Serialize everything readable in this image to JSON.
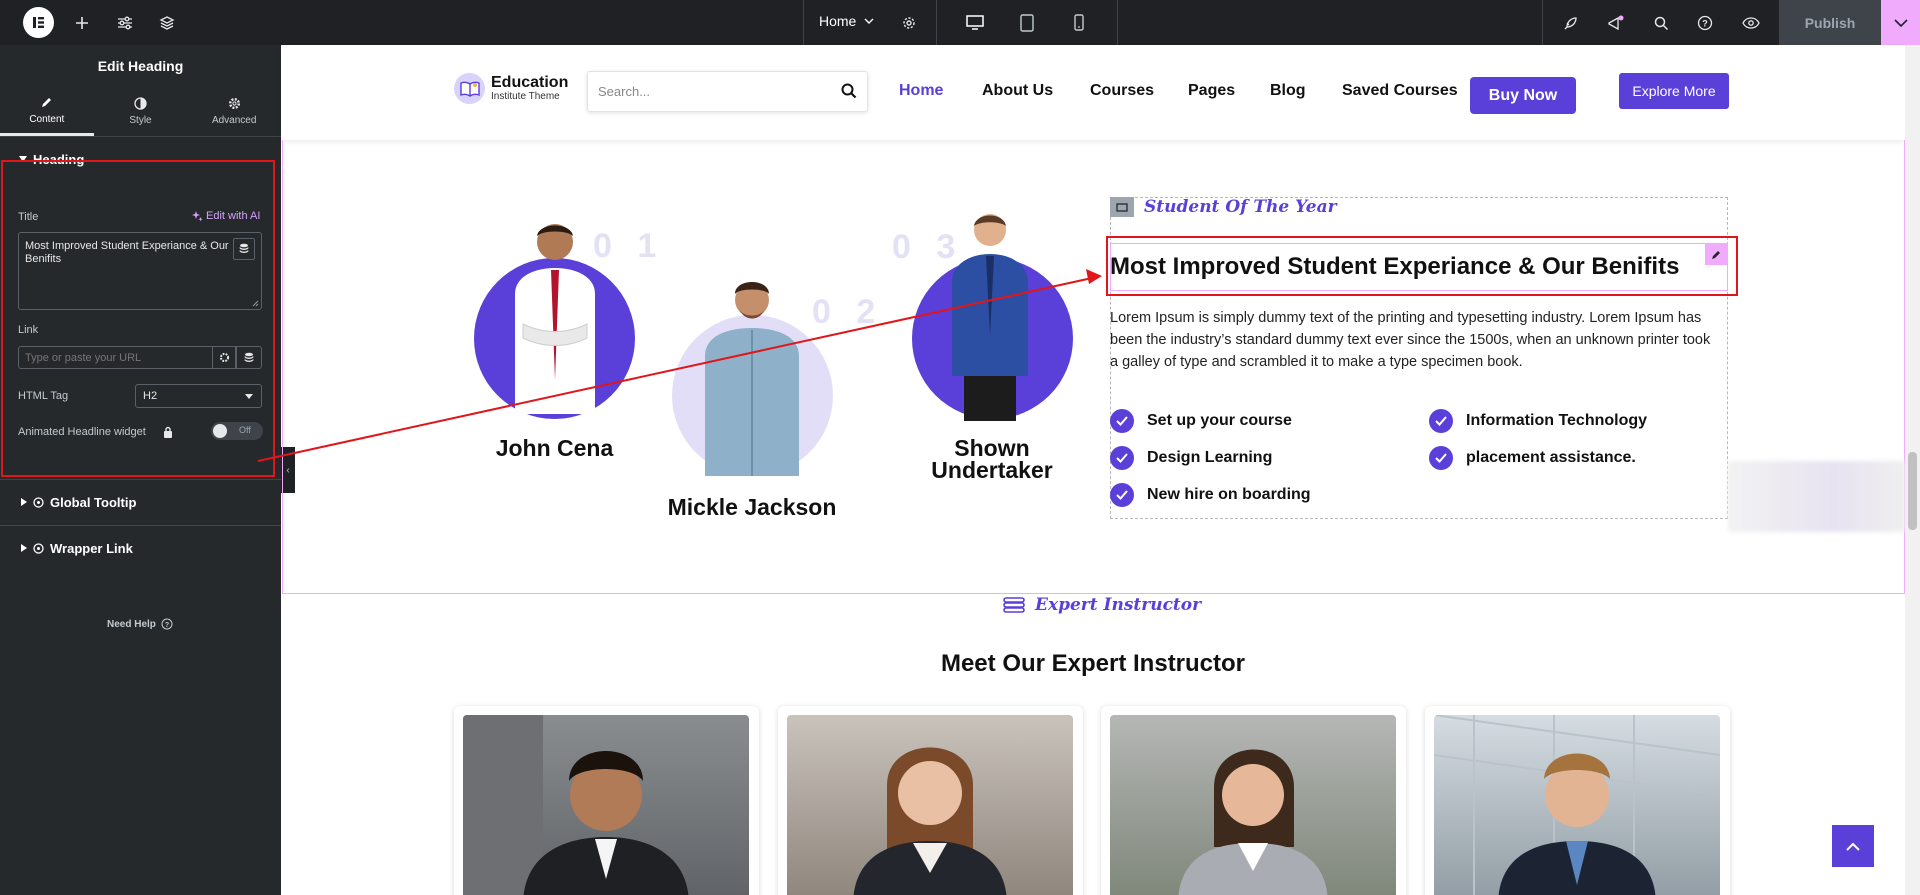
{
  "topbar": {
    "page_name": "Home",
    "publish_label": "Publish"
  },
  "panel": {
    "title": "Edit Heading",
    "tabs": [
      {
        "label": "Content"
      },
      {
        "label": "Style"
      },
      {
        "label": "Advanced"
      }
    ],
    "section_heading": "Heading",
    "title_label": "Title",
    "edit_ai_label": "Edit with AI",
    "title_value": "Most Improved Student Experiance & Our Benifits",
    "link_label": "Link",
    "link_placeholder": "Type or paste your URL",
    "html_tag_label": "HTML Tag",
    "html_tag_value": "H2",
    "animated_label": "Animated Headline widget",
    "toggle_label": "Off",
    "global_tooltip": "Global Tooltip",
    "wrapper_link": "Wrapper Link",
    "need_help": "Need Help"
  },
  "site": {
    "brand_name": "Education",
    "brand_sub": "Institute Theme",
    "search_placeholder": "Search...",
    "nav": [
      "Home",
      "About Us",
      "Courses",
      "Pages",
      "Blog",
      "Saved Courses"
    ],
    "buy_now": "Buy Now",
    "explore_more": "Explore More"
  },
  "students": [
    {
      "name": "John Cena",
      "rank": "0 1"
    },
    {
      "name": "Mickle Jackson",
      "rank": "0 2"
    },
    {
      "name": "Shown Undertaker",
      "rank": "0 3"
    }
  ],
  "about": {
    "eyebrow": "Student Of The Year",
    "heading": "Most Improved Student Experiance & Our Benifits",
    "paragraph": "Lorem Ipsum is simply dummy text of the printing and typesetting industry. Lorem Ipsum has been the industry’s standard dummy text ever since the 1500s, when an unknown printer took a galley of type and scrambled it to make a type specimen book.",
    "checks": [
      "Set up your course",
      "Design Learning",
      "New hire on boarding",
      "Information Technology",
      "placement assistance."
    ]
  },
  "instructors": {
    "eyebrow": "Expert Instructor",
    "title": "Meet Our Expert Instructor"
  },
  "colors": {
    "accent": "#5b3fd9",
    "annotation": "#e0161b",
    "editor_bg": "#26292c"
  }
}
